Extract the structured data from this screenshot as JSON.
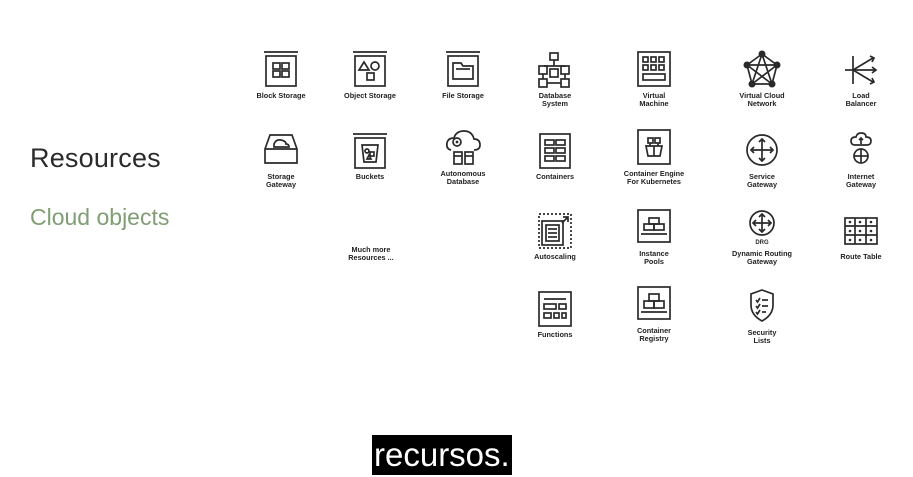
{
  "section": {
    "title": "Resources",
    "subtitle": "Cloud objects"
  },
  "tiles": [
    {
      "label": "Block Storage",
      "icon": "block-storage-icon"
    },
    {
      "label": "Object Storage",
      "icon": "object-storage-icon"
    },
    {
      "label": "File Storage",
      "icon": "file-storage-icon"
    },
    {
      "label": "Database\nSystem",
      "icon": "database-system-icon"
    },
    {
      "label": "Virtual\nMachine",
      "icon": "virtual-machine-icon"
    },
    {
      "label": "Virtual Cloud\nNetwork",
      "icon": "virtual-cloud-network-icon"
    },
    {
      "label": "Load\nBalancer",
      "icon": "load-balancer-icon"
    },
    {
      "label": "Storage\nGateway",
      "icon": "storage-gateway-icon"
    },
    {
      "label": "Buckets",
      "icon": "buckets-icon"
    },
    {
      "label": "Autonomous\nDatabase",
      "icon": "autonomous-database-icon"
    },
    {
      "label": "Containers",
      "icon": "containers-icon"
    },
    {
      "label": "Container Engine\nFor Kubernetes",
      "icon": "container-engine-icon"
    },
    {
      "label": "Service\nGateway",
      "icon": "service-gateway-icon"
    },
    {
      "label": "Internet\nGateway",
      "icon": "internet-gateway-icon"
    },
    {
      "label": "Autoscaling",
      "icon": "autoscaling-icon"
    },
    {
      "label": "Instance\nPools",
      "icon": "instance-pools-icon"
    },
    {
      "label": "Dynamic Routing\nGateway",
      "icon": "drg-icon",
      "icon_text": "DRG"
    },
    {
      "label": "Route Table",
      "icon": "route-table-icon"
    },
    {
      "label": "Functions",
      "icon": "functions-icon"
    },
    {
      "label": "Container\nRegistry",
      "icon": "container-registry-icon"
    },
    {
      "label": "Security\nLists",
      "icon": "security-lists-icon"
    }
  ],
  "more_label": "Much more\nResources ...",
  "caption": "recursos."
}
